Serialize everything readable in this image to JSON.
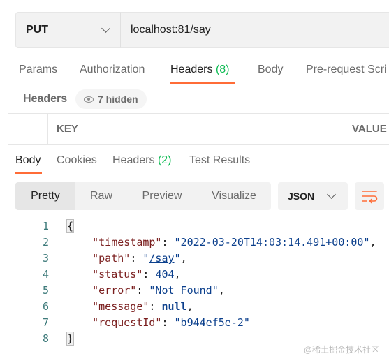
{
  "request": {
    "method": "PUT",
    "url": "localhost:81/say"
  },
  "request_tabs": [
    {
      "label": "Params"
    },
    {
      "label": "Authorization"
    },
    {
      "label": "Headers",
      "count": "(8)"
    },
    {
      "label": "Body"
    },
    {
      "label": "Pre-request Scri"
    }
  ],
  "headers_section": {
    "title": "Headers",
    "hidden_label": "7 hidden",
    "columns": [
      "KEY",
      "VALUE"
    ]
  },
  "response_tabs": [
    {
      "label": "Body"
    },
    {
      "label": "Cookies"
    },
    {
      "label": "Headers",
      "count": "(2)"
    },
    {
      "label": "Test Results"
    }
  ],
  "view_modes": [
    "Pretty",
    "Raw",
    "Preview",
    "Visualize"
  ],
  "format": "JSON",
  "code": {
    "line_numbers": [
      "1",
      "2",
      "3",
      "4",
      "5",
      "6",
      "7",
      "8"
    ],
    "open_brace": "{",
    "close_brace": "}",
    "fields": [
      {
        "key": "\"timestamp\"",
        "value": "\"2022-03-20T14:03:14.491+00:00\""
      },
      {
        "key": "\"path\"",
        "value_pre": "\"",
        "value_link": "/say",
        "value_post": "\""
      },
      {
        "key": "\"status\"",
        "value": "404"
      },
      {
        "key": "\"error\"",
        "value": "\"Not Found\""
      },
      {
        "key": "\"message\"",
        "value": "null"
      },
      {
        "key": "\"requestId\"",
        "value": "\"b944ef5e-2\""
      }
    ]
  },
  "watermark": "@稀土掘金技术社区",
  "colors": {
    "accent": "#ff6c37",
    "count": "#0cbb52"
  }
}
